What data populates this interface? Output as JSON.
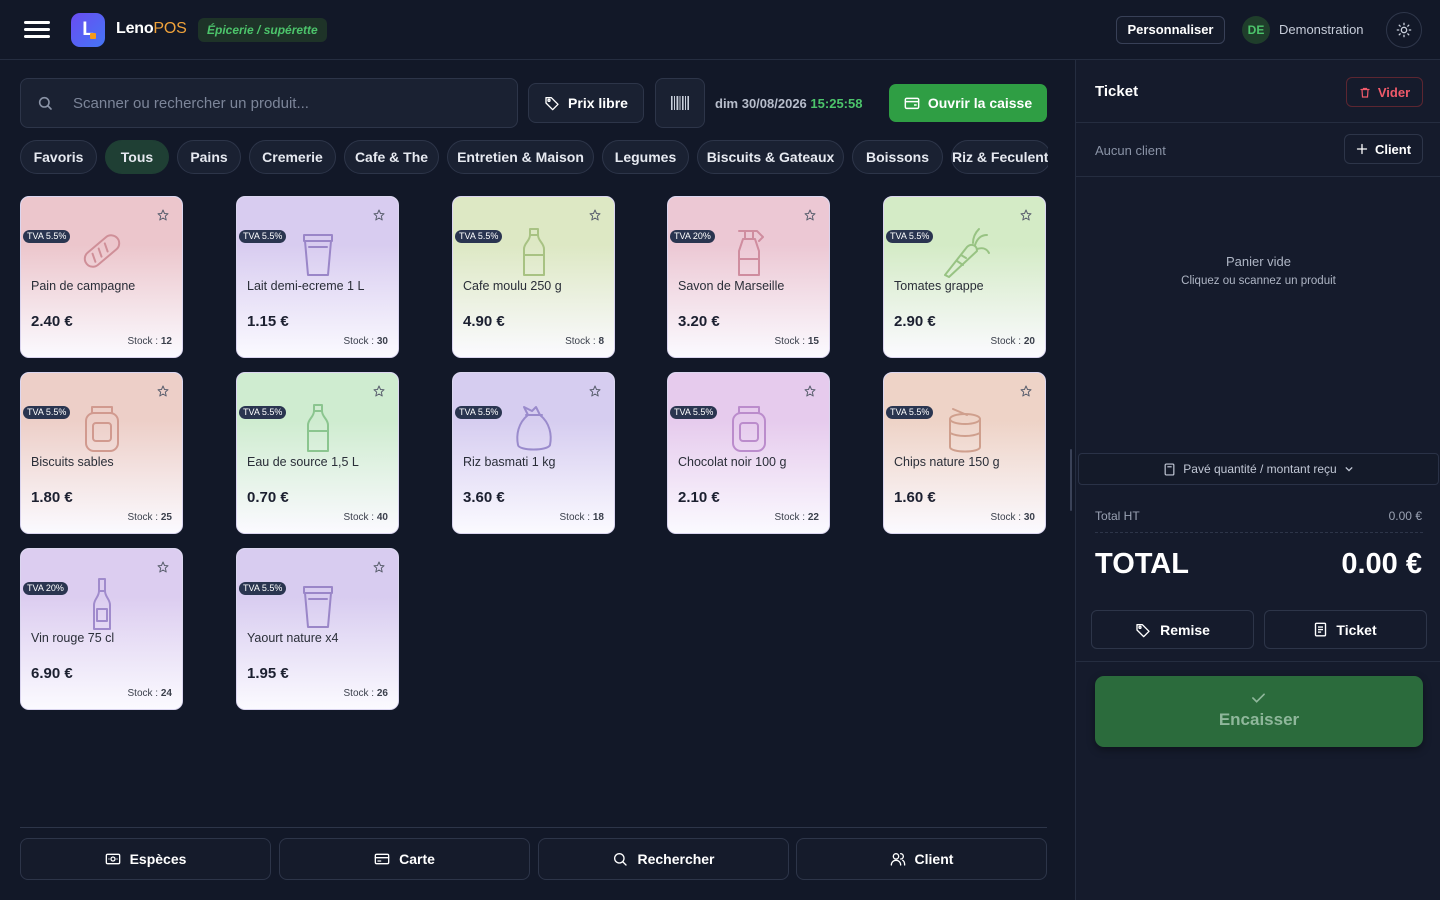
{
  "header": {
    "brand_part1": "Leno",
    "brand_part2": "POS",
    "logo_letter": "L",
    "shop_type": "Épicerie / supérette",
    "customize_label": "Personnaliser",
    "user_initials": "DE",
    "user_name": "Demonstration",
    "icons": [
      "menu-icon",
      "sun-icon"
    ]
  },
  "toolbar": {
    "search_placeholder": "Scanner ou rechercher un produit...",
    "free_price_label": "Prix libre",
    "date": "dim 30/08/2026",
    "time": "15:25:58",
    "open_register_label": "Ouvrir la caisse",
    "icons": [
      "search-icon",
      "tag-icon",
      "barcode-icon",
      "register-icon"
    ]
  },
  "categories": [
    {
      "label": "Favoris",
      "active": false
    },
    {
      "label": "Tous",
      "active": true
    },
    {
      "label": "Pains",
      "active": false
    },
    {
      "label": "Cremerie",
      "active": false
    },
    {
      "label": "Cafe & The",
      "active": false
    },
    {
      "label": "Entretien & Maison",
      "active": false
    },
    {
      "label": "Legumes",
      "active": false
    },
    {
      "label": "Biscuits & Gateaux",
      "active": false
    },
    {
      "label": "Boissons",
      "active": false
    },
    {
      "label": "Riz & Feculents",
      "active": false
    }
  ],
  "products": [
    {
      "name": "Pain de campagne",
      "price": "2.40 €",
      "stock_label": "Stock :",
      "stock": "12",
      "tva": "TVA 5.5%",
      "icon": "bread-icon",
      "tint": "#ecc6cc",
      "stroke": "#cf8f98"
    },
    {
      "name": "Lait demi-ecreme 1 L",
      "price": "1.15 €",
      "stock_label": "Stock :",
      "stock": "30",
      "tva": "TVA 5.5%",
      "icon": "cup-icon",
      "tint": "#d8ccf0",
      "stroke": "#9a86c8"
    },
    {
      "name": "Cafe moulu 250 g",
      "price": "4.90 €",
      "stock_label": "Stock :",
      "stock": "8",
      "tva": "TVA 5.5%",
      "icon": "bottle-icon",
      "tint": "#dde8c4",
      "stroke": "#a8c283"
    },
    {
      "name": "Savon de Marseille",
      "price": "3.20 €",
      "stock_label": "Stock :",
      "stock": "15",
      "tva": "TVA 20%",
      "icon": "spray-bottle-icon",
      "tint": "#ecc8d4",
      "stroke": "#cf8d9f"
    },
    {
      "name": "Tomates grappe",
      "price": "2.90 €",
      "stock_label": "Stock :",
      "stock": "20",
      "tva": "TVA 5.5%",
      "icon": "carrot-icon",
      "tint": "#d4ebc6",
      "stroke": "#98c383"
    },
    {
      "name": "Biscuits sables",
      "price": "1.80 €",
      "stock_label": "Stock :",
      "stock": "25",
      "tva": "TVA 5.5%",
      "icon": "jar-icon",
      "tint": "#edcfc8",
      "stroke": "#d19a8f"
    },
    {
      "name": "Eau de source 1,5 L",
      "price": "0.70 €",
      "stock_label": "Stock :",
      "stock": "40",
      "tva": "TVA 5.5%",
      "icon": "bottle-icon",
      "tint": "#cfecd0",
      "stroke": "#8bc58f"
    },
    {
      "name": "Riz basmati 1 kg",
      "price": "3.60 €",
      "stock_label": "Stock :",
      "stock": "18",
      "tva": "TVA 5.5%",
      "icon": "sack-icon",
      "tint": "#d6cdf0",
      "stroke": "#9a8bcc"
    },
    {
      "name": "Chocolat noir 100 g",
      "price": "2.10 €",
      "stock_label": "Stock :",
      "stock": "22",
      "tva": "TVA 5.5%",
      "icon": "jar-icon",
      "tint": "#e6cbed",
      "stroke": "#bb8ccc"
    },
    {
      "name": "Chips nature 150 g",
      "price": "1.60 €",
      "stock_label": "Stock :",
      "stock": "30",
      "tva": "TVA 5.5%",
      "icon": "can-icon",
      "tint": "#eed3c7",
      "stroke": "#cf9f8d"
    },
    {
      "name": "Vin rouge 75 cl",
      "price": "6.90 €",
      "stock_label": "Stock :",
      "stock": "24",
      "tva": "TVA 20%",
      "icon": "wine-bottle-icon",
      "tint": "#dccdf0",
      "stroke": "#a08bcc"
    },
    {
      "name": "Yaourt nature x4",
      "price": "1.95 €",
      "stock_label": "Stock :",
      "stock": "26",
      "tva": "TVA 5.5%",
      "icon": "cup-icon",
      "tint": "#d8ccf0",
      "stroke": "#9a86c8"
    }
  ],
  "bottom_actions": [
    {
      "label": "Espèces",
      "icon": "cash-icon"
    },
    {
      "label": "Carte",
      "icon": "card-icon"
    },
    {
      "label": "Rechercher",
      "icon": "search-icon"
    },
    {
      "label": "Client",
      "icon": "user-icon"
    }
  ],
  "ticket": {
    "title": "Ticket",
    "clear_label": "Vider",
    "no_client": "Aucun client",
    "add_client_label": "Client",
    "empty_title": "Panier vide",
    "empty_hint": "Cliquez ou scannez un produit",
    "keypad_label": "Pavé quantité / montant reçu",
    "total_ht_label": "Total HT",
    "total_ht_value": "0.00 €",
    "total_label": "TOTAL",
    "total_value": "0.00 €",
    "discount_label": "Remise",
    "receipt_label": "Ticket",
    "checkout_label": "Encaisser"
  },
  "colors": {
    "background": "#121828",
    "panel": "#151b2c",
    "accent_green": "#2f9e44",
    "danger": "#f05a6a"
  }
}
